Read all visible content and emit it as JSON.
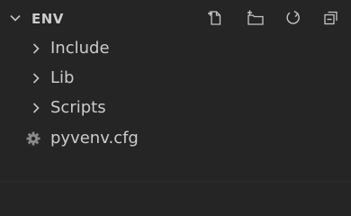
{
  "section": {
    "title": "ENV",
    "expanded": true,
    "actions": [
      {
        "name": "new-file",
        "icon": "new-file-icon"
      },
      {
        "name": "new-folder",
        "icon": "new-folder-icon"
      },
      {
        "name": "refresh",
        "icon": "refresh-icon"
      },
      {
        "name": "collapse-all",
        "icon": "collapse-all-icon"
      }
    ]
  },
  "tree": {
    "items": [
      {
        "label": "Include",
        "type": "folder",
        "expanded": false
      },
      {
        "label": "Lib",
        "type": "folder",
        "expanded": false
      },
      {
        "label": "Scripts",
        "type": "folder",
        "expanded": false
      },
      {
        "label": "pyvenv.cfg",
        "type": "file",
        "icon": "gear-icon"
      }
    ]
  },
  "colors": {
    "background": "#252526",
    "text": "#cccccc",
    "icon": "#c5c5c5",
    "gear_icon": "#8a8a8a"
  }
}
